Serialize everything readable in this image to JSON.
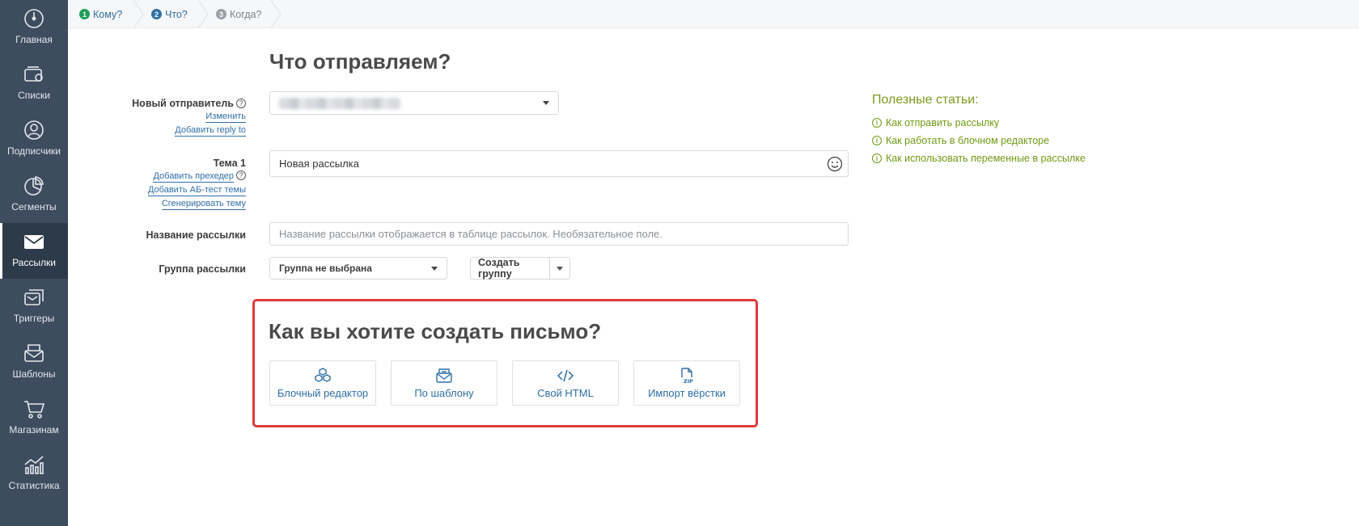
{
  "sidebar": {
    "items": [
      {
        "label": "Главная",
        "icon": "dashboard-icon"
      },
      {
        "label": "Списки",
        "icon": "lists-icon"
      },
      {
        "label": "Подписчики",
        "icon": "user-icon"
      },
      {
        "label": "Сегменты",
        "icon": "pie-chart-icon"
      },
      {
        "label": "Рассылки",
        "icon": "envelope-icon",
        "active": true
      },
      {
        "label": "Триггеры",
        "icon": "triggers-icon"
      },
      {
        "label": "Шаблоны",
        "icon": "templates-icon"
      },
      {
        "label": "Магазинам",
        "icon": "cart-icon"
      },
      {
        "label": "Статистика",
        "icon": "stats-icon"
      }
    ]
  },
  "steps": [
    {
      "num": "1",
      "label": "Кому?",
      "color": "#1e9e5a"
    },
    {
      "num": "2",
      "label": "Что?",
      "color": "#2e6fa5"
    },
    {
      "num": "3",
      "label": "Когда?",
      "color": "#9aa0a6"
    }
  ],
  "page_title": "Что отправляем?",
  "sender": {
    "label": "Новый отправитель",
    "help": "?",
    "link_change": "Изменить",
    "link_reply": "Добавить reply to"
  },
  "subject": {
    "label": "Тема 1",
    "value": "Новая рассылка",
    "link_preheader": "Добавить прехедер",
    "link_ab": "Добавить АБ-тест темы",
    "link_generate": "Сгенерировать тему",
    "help": "?"
  },
  "campaign_name": {
    "label": "Название рассылки",
    "placeholder": "Название рассылки отображается в таблице рассылок. Необязательное поле."
  },
  "group": {
    "label": "Группа рассылки",
    "selected": "Группа не выбрана",
    "create_button": "Создать группу"
  },
  "articles": {
    "title": "Полезные статьи:",
    "items": [
      "Как отправить рассылку",
      "Как работать в блочном редакторе",
      "Как использовать переменные в рассылке"
    ]
  },
  "create": {
    "title": "Как вы хотите создать письмо?",
    "options": [
      {
        "label": "Блочный редактор",
        "icon": "blocks-icon"
      },
      {
        "label": "По шаблону",
        "icon": "template-envelope-icon"
      },
      {
        "label": "Свой HTML",
        "icon": "code-icon"
      },
      {
        "label": "Импорт вёрстки",
        "icon": "zip-file-icon"
      }
    ]
  },
  "colors": {
    "sidebar": "#3d4c5e",
    "link": "#2e6fa5",
    "articles": "#6f9a12",
    "highlight": "#e03a3a"
  }
}
